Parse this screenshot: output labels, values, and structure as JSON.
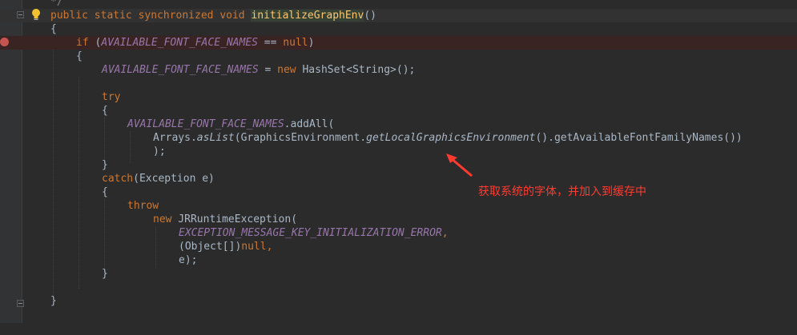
{
  "editor": {
    "lines": {
      "l0": {
        "comment": "*/"
      },
      "l1": {
        "p1": "public static synchronized void ",
        "method": "initializeGraphEnv",
        "p2": "()"
      },
      "l2": {
        "text": "{"
      },
      "l3": {
        "if_kw": "if",
        "p1": " (",
        "field": "AVAILABLE_FONT_FACE_NAMES",
        "p2": " == ",
        "null_kw": "null",
        "p3": ")"
      },
      "l4": {
        "text": "{"
      },
      "l5": {
        "field": "AVAILABLE_FONT_FACE_NAMES",
        "p1": " = ",
        "new_kw": "new",
        "p2": " HashSet<String>();"
      },
      "l7": {
        "try_kw": "try"
      },
      "l8": {
        "text": "{"
      },
      "l9": {
        "field": "AVAILABLE_FONT_FACE_NAMES",
        "p1": ".addAll("
      },
      "l10": {
        "p1": "Arrays.",
        "m1": "asList",
        "p2": "(GraphicsEnvironment.",
        "m2": "getLocalGraphicsEnvironment",
        "p3": "().getAvailableFontFamilyNames())"
      },
      "l11": {
        "text": ");"
      },
      "l12": {
        "text": "}"
      },
      "l13": {
        "catch_kw": "catch",
        "p1": "(Exception e)"
      },
      "l14": {
        "text": "{"
      },
      "l15": {
        "throw_kw": "throw"
      },
      "l16": {
        "new_kw": "new",
        "p1": " JRRuntimeException("
      },
      "l17": {
        "field": "EXCEPTION_MESSAGE_KEY_INITIALIZATION_ERROR",
        "comma": ","
      },
      "l18": {
        "p1": "(Object[])",
        "null_kw": "null",
        "comma": ","
      },
      "l19": {
        "text": "e);"
      },
      "l20": {
        "text": "}"
      },
      "l21": {
        "text": "}"
      }
    },
    "annotation": {
      "text": "获取系统的字体，并加入到缓存中",
      "color": "#ff3b30"
    }
  },
  "colors": {
    "background": "#2b2b2b",
    "keyword": "#cc7832",
    "field": "#9876aa",
    "text": "#a9b7c6",
    "method_highlight": "#ffc66d",
    "breakpoint": "#c75450"
  },
  "icons": [
    "intention-bulb-icon",
    "breakpoint-icon",
    "fold-icon"
  ]
}
